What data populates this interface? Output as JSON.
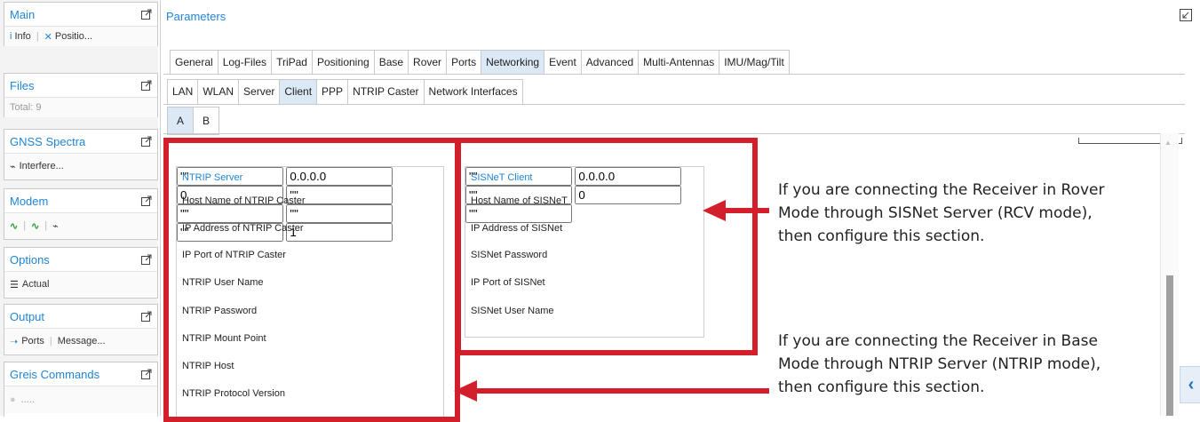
{
  "left_panels": [
    {
      "title": "Main",
      "items": [
        "Info",
        "Positio..."
      ],
      "item_icons": [
        "info-icon",
        "position-icon"
      ]
    },
    {
      "title": "Files",
      "items": [
        "Total: 9"
      ]
    },
    {
      "title": "GNSS Spectra",
      "items": [
        "Interfere..."
      ],
      "item_icons": [
        "chart-icon"
      ]
    },
    {
      "title": "Modem",
      "icons": [
        "link-green-icon",
        "link-green-icon",
        "chart-icon"
      ]
    },
    {
      "title": "Options",
      "items": [
        "Actual"
      ],
      "item_icons": [
        "list-icon"
      ]
    },
    {
      "title": "Output",
      "items": [
        "Ports",
        "Message..."
      ],
      "item_icons": [
        "arrow-icon"
      ]
    },
    {
      "title": "Greis Commands",
      "items": [
        "....."
      ],
      "item_icons": [
        "circle-icon"
      ]
    }
  ],
  "parameters": {
    "title": "Parameters",
    "tabs_main": [
      "General",
      "Log-Files",
      "TriPad",
      "Positioning",
      "Base",
      "Rover",
      "Ports",
      "Networking",
      "Event",
      "Advanced",
      "Multi-Antennas",
      "IMU/Mag/Tilt"
    ],
    "tabs_main_active": "Networking",
    "tabs_net": [
      "LAN",
      "WLAN",
      "Server",
      "Client",
      "PPP",
      "NTRIP Caster",
      "Network Interfaces"
    ],
    "tabs_net_active": "Client",
    "tabs_client": [
      "A",
      "B"
    ],
    "tabs_client_active": "A"
  },
  "ntrip_server": {
    "title": "NTRIP Server",
    "fields": [
      {
        "label": "Host Name of NTRIP Caster",
        "value": "\"\""
      },
      {
        "label": "IP Address of NTRIP Caster",
        "value": "0.0.0.0"
      },
      {
        "label": "IP Port of NTRIP Caster",
        "value": "0"
      },
      {
        "label": "NTRIP User Name",
        "value": "\"\""
      },
      {
        "label": "NTRIP Password",
        "value": "\"\""
      },
      {
        "label": "NTRIP Mount Point",
        "value": "\"\""
      },
      {
        "label": "NTRIP Host",
        "value": "\"\""
      },
      {
        "label": "NTRIP Protocol Version",
        "value": "1"
      }
    ]
  },
  "sisnet_client": {
    "title": "SISNeT Client",
    "fields": [
      {
        "label": "Host Name of SISNeT",
        "value": "\"\""
      },
      {
        "label": "IP Address of SISNet",
        "value": "0.0.0.0"
      },
      {
        "label": "SISNet Password",
        "value": "\"\""
      },
      {
        "label": "IP Port of SISNet",
        "value": "0"
      },
      {
        "label": "SISNet User Name",
        "value": "\"\""
      }
    ]
  },
  "annotations": {
    "rover": "If you are connecting the Receiver in Rover Mode through SISNet Server (RCV mode), then configure this section.",
    "base": "If you are connecting the Receiver in Base Mode through NTRIP Server (NTRIP mode), then configure this section."
  },
  "colors": {
    "accent": "#1f84d6",
    "callout": "#d21f2b"
  }
}
